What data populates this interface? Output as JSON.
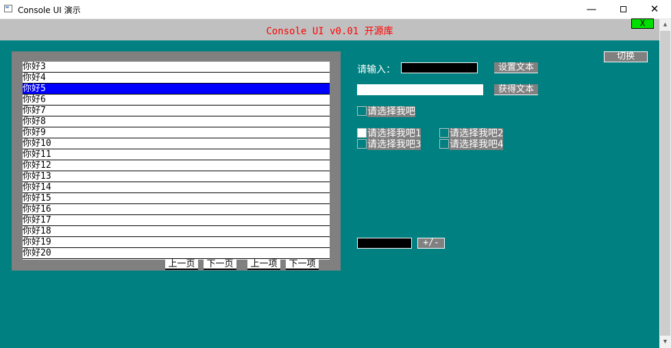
{
  "window": {
    "title": "Console UI 演示",
    "controls": {
      "minimize": "—",
      "close": "✕"
    }
  },
  "header": {
    "title": "Console UI v0.01 开源库",
    "close_label": "X",
    "close_color": "#00e000",
    "title_color": "#ff0000"
  },
  "colors": {
    "background": "#008080",
    "panel": "#808080",
    "header_bg": "#c0c0c0",
    "selected": "#0000ff"
  },
  "list": {
    "selected_index": 2,
    "items": [
      "你好3",
      "你好4",
      "你好5",
      "你好6",
      "你好7",
      "你好8",
      "你好9",
      "你好10",
      "你好11",
      "你好12",
      "你好13",
      "你好14",
      "你好15",
      "你好16",
      "你好17",
      "你好18",
      "你好19",
      "你好20"
    ],
    "buttons": {
      "prev_page": "上一页",
      "next_page": "下一页",
      "prev_item": "上一项",
      "next_item": "下一项"
    }
  },
  "form": {
    "switch_label": "切换",
    "input_label": "请输入：",
    "input_value": "",
    "set_text_label": "设置文本",
    "get_text_label": "获得文本",
    "output_value": "",
    "checkbox": {
      "label": "请选择我吧",
      "checked": false
    },
    "radios": [
      {
        "label": "请选择我吧1",
        "checked": true
      },
      {
        "label": "请选择我吧2",
        "checked": false
      },
      {
        "label": "请选择我吧3",
        "checked": false
      },
      {
        "label": "请选择我吧4",
        "checked": false
      }
    ],
    "number_value": "",
    "toggle_sign_label": "+/-"
  },
  "scrollbar": {
    "up_icon": "▲",
    "down_icon": "▼"
  }
}
